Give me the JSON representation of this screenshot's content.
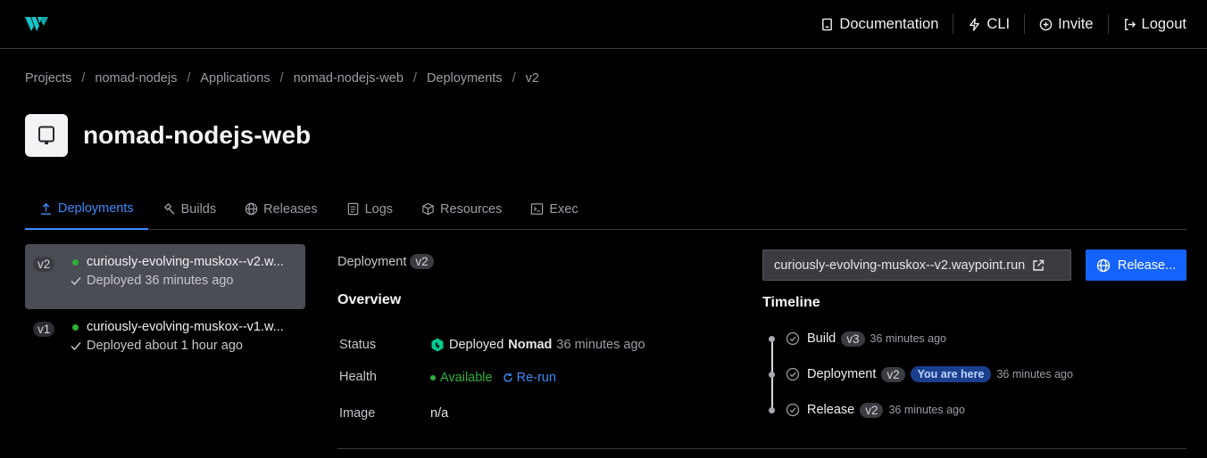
{
  "topnav": {
    "documentation": "Documentation",
    "cli": "CLI",
    "invite": "Invite",
    "logout": "Logout"
  },
  "breadcrumb": [
    "Projects",
    "nomad-nodejs",
    "Applications",
    "nomad-nodejs-web",
    "Deployments",
    "v2"
  ],
  "app": {
    "title": "nomad-nodejs-web"
  },
  "tabs": [
    "Deployments",
    "Builds",
    "Releases",
    "Logs",
    "Resources",
    "Exec"
  ],
  "deployments": [
    {
      "version": "v2",
      "name": "curiously-evolving-muskox--v2.w...",
      "status": "Deployed 36 minutes ago"
    },
    {
      "version": "v1",
      "name": "curiously-evolving-muskox--v1.w...",
      "status": "Deployed about 1 hour ago"
    }
  ],
  "detail": {
    "label": "Deployment",
    "version": "v2",
    "overview": "Overview",
    "status_label": "Status",
    "status_prefix": "Deployed",
    "status_platform": "Nomad",
    "status_time": "36 minutes ago",
    "health_label": "Health",
    "health_value": "Available",
    "rerun": "Re-run",
    "image_label": "Image",
    "image_value": "n/a"
  },
  "actions": {
    "url": "curiously-evolving-muskox--v2.waypoint.run",
    "release": "Release..."
  },
  "timeline": {
    "title": "Timeline",
    "items": [
      {
        "name": "Build",
        "version": "v3",
        "time": "36 minutes ago"
      },
      {
        "name": "Deployment",
        "version": "v2",
        "badge": "You are here",
        "time": "36 minutes ago"
      },
      {
        "name": "Release",
        "version": "v2",
        "time": "36 minutes ago"
      }
    ]
  },
  "colors": {
    "accent": "#1563ff",
    "success": "#2eb039",
    "background": "#000000"
  }
}
